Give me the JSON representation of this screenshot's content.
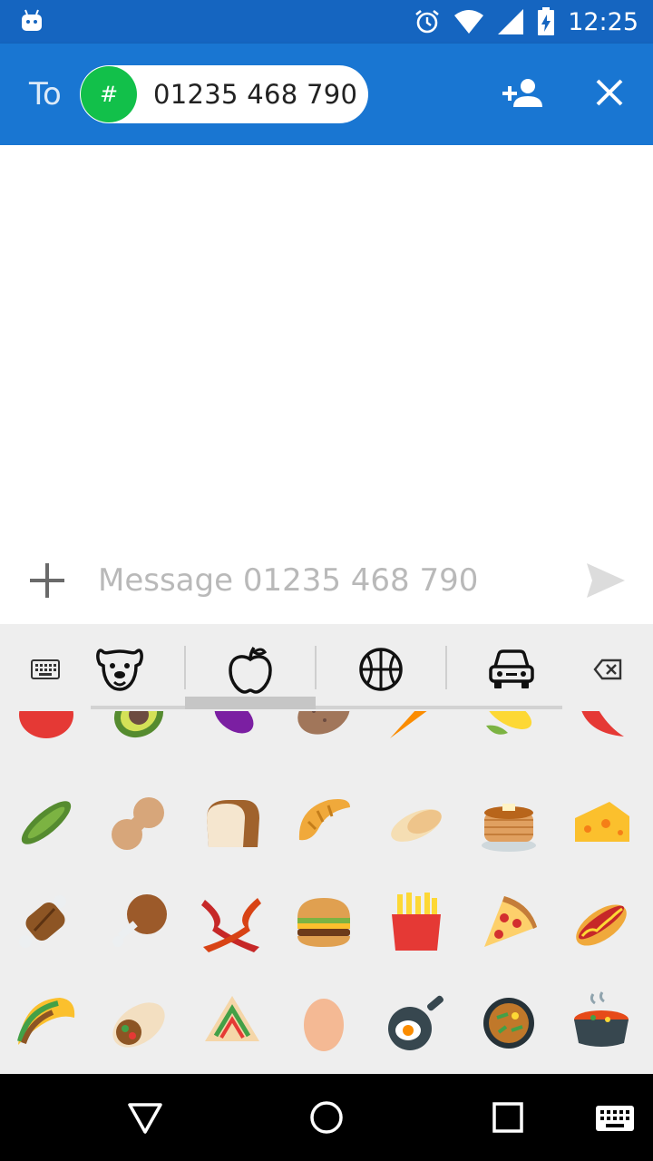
{
  "status_bar": {
    "time": "12:25"
  },
  "header": {
    "to_label": "To",
    "recipient": {
      "avatar_symbol": "#",
      "number": "01235 468 790"
    }
  },
  "compose": {
    "placeholder": "Message 01235 468 790"
  },
  "emoji_keyboard": {
    "categories": [
      "animals-nature",
      "food-drink",
      "activity",
      "travel-places"
    ],
    "selected_category": "food-drink",
    "rows": [
      [
        "tomato",
        "avocado",
        "eggplant",
        "potato",
        "carrot",
        "corn",
        "hot-pepper"
      ],
      [
        "cucumber",
        "peanuts",
        "bread",
        "croissant",
        "baguette",
        "pancakes",
        "cheese"
      ],
      [
        "meat-on-bone",
        "poultry-leg",
        "bacon",
        "hamburger",
        "french-fries",
        "pizza",
        "hot-dog"
      ],
      [
        "taco",
        "burrito",
        "stuffed-flatbread",
        "egg",
        "cooking",
        "shallow-pan-of-food",
        "pot-of-food"
      ]
    ]
  },
  "colors": {
    "status_bar": "#1565c0",
    "app_bar": "#1976d2",
    "avatar": "#12c04a",
    "keyboard_bg": "#eeeeee"
  }
}
